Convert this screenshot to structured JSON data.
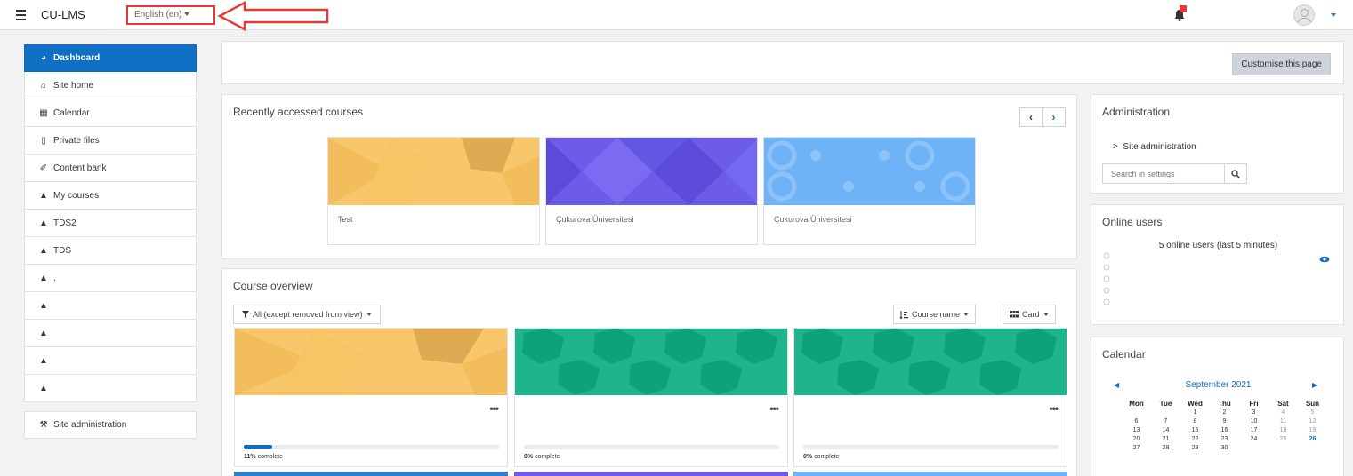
{
  "navbar": {
    "brand": "CU-LMS",
    "language": "English (en)",
    "notification_count": "5"
  },
  "sidebar": {
    "items": [
      {
        "label": "Dashboard",
        "icon": "dashboard-icon"
      },
      {
        "label": "Site home",
        "icon": "home-icon"
      },
      {
        "label": "Calendar",
        "icon": "calendar-icon"
      },
      {
        "label": "Private files",
        "icon": "file-icon"
      },
      {
        "label": "Content bank",
        "icon": "brush-icon"
      },
      {
        "label": "My courses",
        "icon": "graduation-cap-icon"
      },
      {
        "label": "TDS2",
        "icon": "graduation-cap-icon"
      },
      {
        "label": "TDS",
        "icon": "graduation-cap-icon"
      },
      {
        "label": ".",
        "icon": "graduation-cap-icon"
      },
      {
        "label": "",
        "icon": "graduation-cap-icon"
      },
      {
        "label": "",
        "icon": "graduation-cap-icon"
      },
      {
        "label": "",
        "icon": "graduation-cap-icon"
      },
      {
        "label": "",
        "icon": "graduation-cap-icon"
      }
    ],
    "site_admin": "Site administration"
  },
  "header": {
    "customise_label": "Customise this page"
  },
  "recent": {
    "title": "Recently accessed courses",
    "courses": [
      {
        "name": "Test",
        "color": "#f9c76b"
      },
      {
        "name": "Çukurova Üniversitesi",
        "color": "#6c5ce7"
      },
      {
        "name": "Çukurova Üniversitesi",
        "color": "#6fb3f7"
      }
    ]
  },
  "overview": {
    "title": "Course overview",
    "filter_label": "All (except removed from view)",
    "sort_label": "Course name",
    "view_label": "Card",
    "courses": [
      {
        "progress": 11,
        "pct_value": "11%",
        "pct_suffix": " complete",
        "color": "#f9c76b"
      },
      {
        "progress": 0,
        "pct_value": "0%",
        "pct_suffix": " complete",
        "color": "#1eb58c"
      },
      {
        "progress": 0,
        "pct_value": "0%",
        "pct_suffix": " complete",
        "color": "#1eb58c"
      }
    ]
  },
  "admin": {
    "title": "Administration",
    "link": "Site administration",
    "search_placeholder": "Search in settings"
  },
  "online": {
    "title": "Online users",
    "count_text": "5 online users (last 5 minutes)"
  },
  "calendar": {
    "title": "Calendar",
    "month": "September 2021",
    "days": [
      "Mon",
      "Tue",
      "Wed",
      "Thu",
      "Fri",
      "Sat",
      "Sun"
    ],
    "weeks": [
      [
        "",
        "",
        "1",
        "2",
        "3",
        "4",
        "5"
      ],
      [
        "6",
        "7",
        "8",
        "9",
        "10",
        "11",
        "12"
      ],
      [
        "13",
        "14",
        "15",
        "16",
        "17",
        "18",
        "19"
      ],
      [
        "20",
        "21",
        "22",
        "23",
        "24",
        "25",
        "26"
      ],
      [
        "27",
        "28",
        "29",
        "30",
        "",
        "",
        ""
      ]
    ],
    "today": "26"
  }
}
